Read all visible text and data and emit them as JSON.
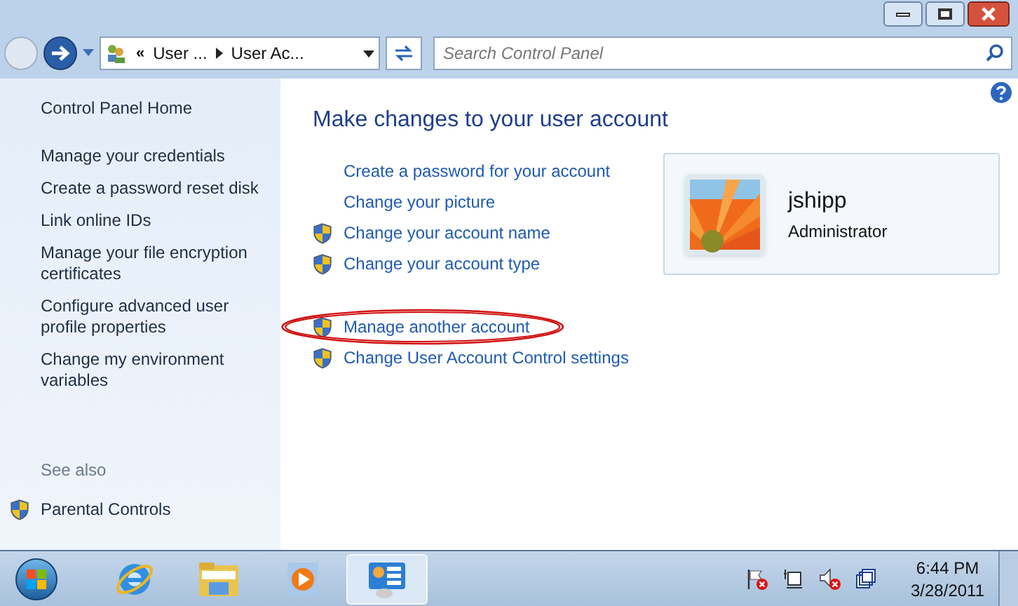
{
  "address": {
    "prefix": "«",
    "crumbs": [
      "User ...",
      "User Ac..."
    ]
  },
  "search": {
    "placeholder": "Search Control Panel"
  },
  "sidebar": {
    "home": "Control Panel Home",
    "items": [
      "Manage your credentials",
      "Create a password reset disk",
      "Link online IDs",
      "Manage your file encryption certificates",
      "Configure advanced user profile properties",
      "Change my environment variables"
    ],
    "see_also": "See also",
    "see_also_items": [
      {
        "label": "Parental Controls",
        "shield": true
      }
    ]
  },
  "main": {
    "heading": "Make changes to your user account",
    "task_groups": [
      [
        {
          "label": "Create a password for your account",
          "shield": false,
          "circled": false
        },
        {
          "label": "Change your picture",
          "shield": false,
          "circled": false
        },
        {
          "label": "Change your account name",
          "shield": true,
          "circled": false
        },
        {
          "label": "Change your account type",
          "shield": true,
          "circled": false
        }
      ],
      [
        {
          "label": "Manage another account",
          "shield": true,
          "circled": true
        },
        {
          "label": "Change User Account Control settings",
          "shield": true,
          "circled": false
        }
      ]
    ]
  },
  "account": {
    "name": "jshipp",
    "role": "Administrator"
  },
  "taskbar": {
    "apps": [
      {
        "kind": "browser",
        "selected": false
      },
      {
        "kind": "folder",
        "selected": false
      },
      {
        "kind": "media",
        "selected": false
      },
      {
        "kind": "control-panel",
        "selected": true
      }
    ],
    "time": "6:44 PM",
    "date": "3/28/2011"
  }
}
